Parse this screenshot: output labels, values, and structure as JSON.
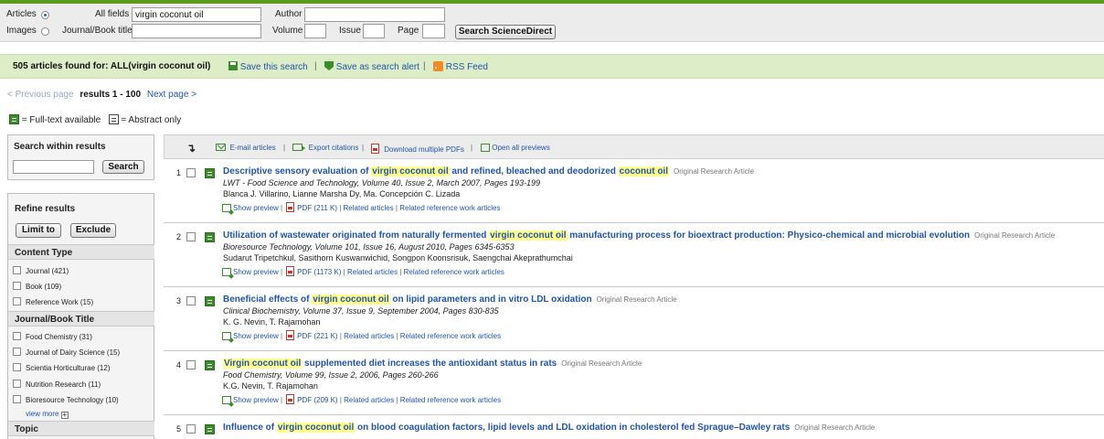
{
  "search": {
    "articles_label": "Articles",
    "images_label": "Images",
    "all_fields_label": "All fields",
    "all_fields_value": "virgin coconut oil",
    "author_label": "Author",
    "author_value": "",
    "journal_label": "Journal/Book title",
    "journal_value": "",
    "volume_label": "Volume",
    "issue_label": "Issue",
    "page_label": "Page",
    "search_button": "Search ScienceDirect"
  },
  "found_bar": {
    "count_text": "505 articles found for: ALL(virgin coconut oil)",
    "save_search": "Save this search",
    "save_alert": "Save as search alert",
    "rss": "RSS Feed"
  },
  "pager": {
    "prev": "< Previous page",
    "range": "results 1 - 100",
    "next": "Next page >"
  },
  "legend": {
    "full_text": "= Full-text available",
    "abstract": "= Abstract only"
  },
  "sidebar": {
    "search_within_title": "Search within results",
    "search_within_value": "",
    "search_button": "Search",
    "refine_title": "Refine results",
    "limit_button": "Limit to",
    "exclude_button": "Exclude",
    "content_type_title": "Content Type",
    "content_types": [
      {
        "label": "Journal (421)"
      },
      {
        "label": "Book (109)"
      },
      {
        "label": "Reference Work (15)"
      }
    ],
    "journal_title": "Journal/Book Title",
    "journals": [
      {
        "label": "Food Chemistry (31)"
      },
      {
        "label": "Journal of Dairy Science (15)"
      },
      {
        "label": "Scientia Horticulturae (12)"
      },
      {
        "label": "Nutrition Research (11)"
      },
      {
        "label": "Bioresource Technology (10)"
      }
    ],
    "view_more": "view more",
    "topic_title": "Topic"
  },
  "toolbar": {
    "email": "E-mail articles",
    "export": "Export citations",
    "download": "Download multiple PDFs",
    "open_previews": "Open all previews"
  },
  "results": [
    {
      "num": "1",
      "title_parts": [
        "Descriptive sensory evaluation of ",
        "virgin coconut oil",
        " and refined, bleached and deodorized ",
        "coconut oil"
      ],
      "type": "Original Research Article",
      "source": "LWT - Food Science and Technology, Volume 40, Issue 2, March 2007, Pages 193-199",
      "authors": "Blanca J. Villarino, Lianne Marsha Dy, Ma. Concepción C. Lizada",
      "pdf": "PDF (211 K)"
    },
    {
      "num": "2",
      "title_parts": [
        "Utilization of wastewater originated from naturally fermented ",
        "virgin coconut oil",
        " manufacturing process for bioextract production: Physico-chemical and microbial evolution",
        ""
      ],
      "type": "Original Research Article",
      "source": "Bioresource Technology, Volume 101, Issue 16, August 2010, Pages 6345-6353",
      "authors": "Sudarut Tripetchkul, Sasithorn Kuswanwichid, Songpon Koonsrisuk, Saengchai Akeprathumchai",
      "pdf": "PDF (1173 K)"
    },
    {
      "num": "3",
      "title_parts": [
        "Beneficial effects of ",
        "virgin coconut oil",
        " on lipid parameters and in vitro LDL oxidation",
        ""
      ],
      "type": "Original Research Article",
      "source": "Clinical Biochemistry, Volume 37, Issue 9, September 2004, Pages 830-835",
      "authors": "K. G. Nevin, T. Rajamohan",
      "pdf": "PDF (221 K)"
    },
    {
      "num": "4",
      "title_parts": [
        "",
        "Virgin coconut oil",
        " supplemented diet increases the antioxidant status in rats",
        ""
      ],
      "type": "Original Research Article",
      "source": "Food Chemistry, Volume 99, Issue 2, 2006, Pages 260-266",
      "authors": "K.G. Nevin, T. Rajamohan",
      "pdf": "PDF (209 K)"
    },
    {
      "num": "5",
      "title_parts": [
        "Influence of ",
        "virgin coconut oil",
        " on blood coagulation factors, lipid levels and LDL oxidation in cholesterol fed Sprague–Dawley rats",
        ""
      ],
      "type": "Original Research Article",
      "source": "",
      "authors": "",
      "pdf": ""
    }
  ],
  "result_actions": {
    "show_preview": "Show preview",
    "related": "Related articles",
    "related_ref": "Related reference work articles"
  }
}
